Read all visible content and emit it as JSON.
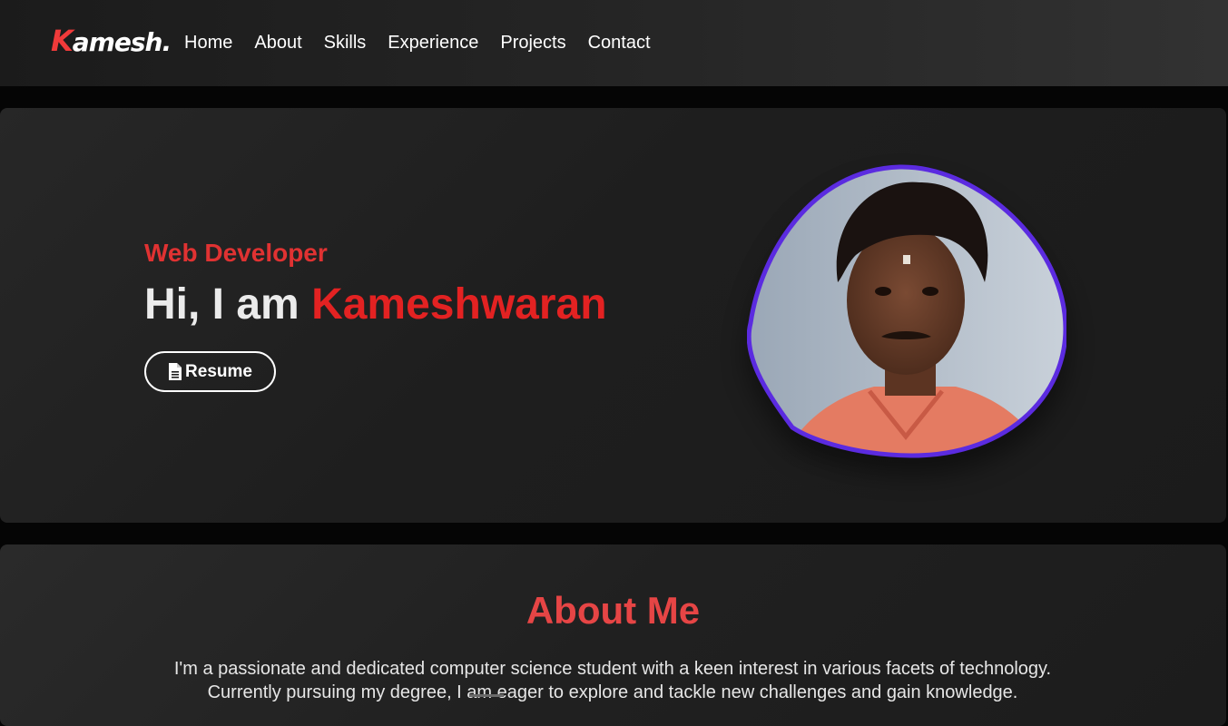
{
  "navbar": {
    "logo_first": "K",
    "logo_rest": "amesh.",
    "links": [
      "Home",
      "About",
      "Skills",
      "Experience",
      "Projects",
      "Contact"
    ]
  },
  "hero": {
    "subtitle": "Web Developer",
    "greeting": "Hi, I am",
    "name": "Kameshwaran",
    "resume_label": "Resume",
    "resume_icon": "file-icon",
    "photo_icon": "profile-photo"
  },
  "about": {
    "title": "About Me",
    "text": "I'm a passionate and dedicated computer science student with a keen interest in various facets of technology. Currently pursuing my degree, I am eager to explore and tackle new challenges and gain knowledge."
  },
  "colors": {
    "accent_red": "#e32222",
    "photo_border": "#5b2be0",
    "background": "#050505"
  }
}
